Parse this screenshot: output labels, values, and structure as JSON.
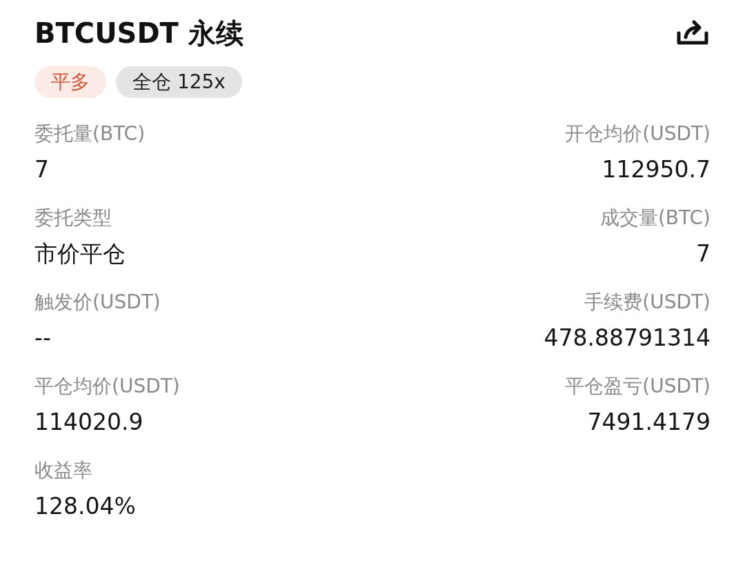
{
  "header": {
    "title": "BTCUSDT 永续"
  },
  "tags": [
    {
      "label": "平多",
      "color": "#d6583a"
    },
    {
      "label": "全仓 125x",
      "color": "#1e1e1e"
    }
  ],
  "fields": [
    {
      "label": "委托量(BTC)",
      "value": "7"
    },
    {
      "label": "开仓均价(USDT)",
      "value": "112950.7"
    },
    {
      "label": "委托类型",
      "value": "市价平仓"
    },
    {
      "label": "成交量(BTC)",
      "value": "7"
    },
    {
      "label": "触发价(USDT)",
      "value": "--"
    },
    {
      "label": "手续费(USDT)",
      "value": "478.88791314"
    },
    {
      "label": "平仓均价(USDT)",
      "value": "114020.9"
    },
    {
      "label": "平仓盈亏(USDT)",
      "value": "7491.4179"
    },
    {
      "label": "收益率",
      "value": "128.04%"
    }
  ]
}
